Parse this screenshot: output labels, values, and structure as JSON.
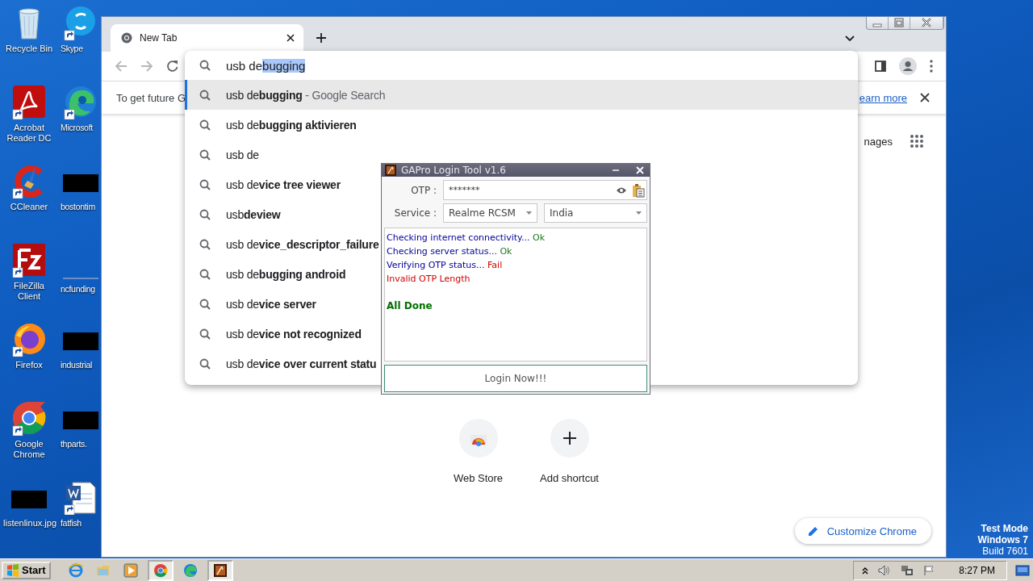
{
  "desktop": {
    "icons": [
      {
        "label": "Recycle Bin",
        "kind": "recycle"
      },
      {
        "label": "Acrobat Reader DC",
        "kind": "acrobat"
      },
      {
        "label": "CCleaner",
        "kind": "ccleaner"
      },
      {
        "label": "FileZilla Client",
        "kind": "filezilla"
      },
      {
        "label": "Firefox",
        "kind": "firefox"
      },
      {
        "label": "Google Chrome",
        "kind": "chrome"
      },
      {
        "label": "listenlinux.jpg",
        "kind": "redacted"
      },
      {
        "label": "Skype",
        "kind": "skype"
      },
      {
        "label": "Microsoft",
        "kind": "edge"
      },
      {
        "label": "bostontim",
        "kind": "redacted"
      },
      {
        "label": "ncfunding",
        "kind": "blank"
      },
      {
        "label": "industrial",
        "kind": "redacted"
      },
      {
        "label": "thparts.",
        "kind": "redacted"
      },
      {
        "label": "fatfish",
        "kind": "word"
      }
    ],
    "notice": [
      "Test Mode",
      "Windows 7",
      "Build 7601"
    ]
  },
  "browser": {
    "tab": {
      "title": "New Tab"
    },
    "infobar": {
      "text": "To get future G",
      "link": "earn more"
    },
    "omnibox": {
      "typed": "usb de",
      "completion": "bugging"
    },
    "suggestions": [
      {
        "text": "usb de**bugging**",
        "suffix": "- Google Search",
        "selected": true
      },
      {
        "text": "usb de**bugging aktivieren**",
        "selected": false
      },
      {
        "text": "usb de",
        "selected": false
      },
      {
        "text": "usb de**vice tree viewer**",
        "selected": false
      },
      {
        "text": "usb**deview**",
        "selected": false
      },
      {
        "text": "usb de**vice_descriptor_failure**",
        "selected": false
      },
      {
        "text": "usb de**bugging android**",
        "selected": false
      },
      {
        "text": "usb de**vice server**",
        "selected": false
      },
      {
        "text": "usb de**vice not recognized**",
        "selected": false
      },
      {
        "text": "usb de**vice over current statu**",
        "selected": false
      }
    ],
    "header_link": "nages",
    "shortcuts": [
      {
        "label": "Web Store",
        "kind": "webstore"
      },
      {
        "label": "Add shortcut",
        "kind": "add"
      }
    ],
    "customize_button": "Customize Chrome"
  },
  "dialog": {
    "title": "GAPro Login Tool v1.6",
    "otp": {
      "label": "OTP :",
      "value": "*******"
    },
    "service": {
      "label": "Service :",
      "value": "Realme RCSM",
      "region": "India"
    },
    "log": [
      {
        "kind": "line",
        "segments": [
          {
            "text": "Checking internet connectivity...",
            "color": "#00009c"
          },
          {
            "text": " Ok",
            "color": "#1a7a1a"
          }
        ]
      },
      {
        "kind": "line",
        "segments": [
          {
            "text": "Checking server status...",
            "color": "#00009c"
          },
          {
            "text": " Ok",
            "color": "#1a7a1a"
          }
        ]
      },
      {
        "kind": "line",
        "segments": [
          {
            "text": "Verifying OTP status...",
            "color": "#00009c"
          },
          {
            "text": " Fail",
            "color": "#d00000"
          }
        ]
      },
      {
        "kind": "line",
        "segments": [
          {
            "text": "Invalid OTP Length",
            "color": "#d00000"
          }
        ]
      },
      {
        "kind": "result",
        "segments": [
          {
            "text": "All Done",
            "color": "#007000"
          }
        ]
      }
    ],
    "button": "Login Now!!!"
  },
  "taskbar": {
    "start": "Start",
    "apps": [
      {
        "kind": "ie",
        "open": false
      },
      {
        "kind": "explorer",
        "open": false
      },
      {
        "kind": "media",
        "open": false
      },
      {
        "kind": "chrome",
        "open": true
      },
      {
        "kind": "edge",
        "open": false
      },
      {
        "kind": "gapro",
        "open": true
      }
    ],
    "clock": "8:27 PM"
  }
}
